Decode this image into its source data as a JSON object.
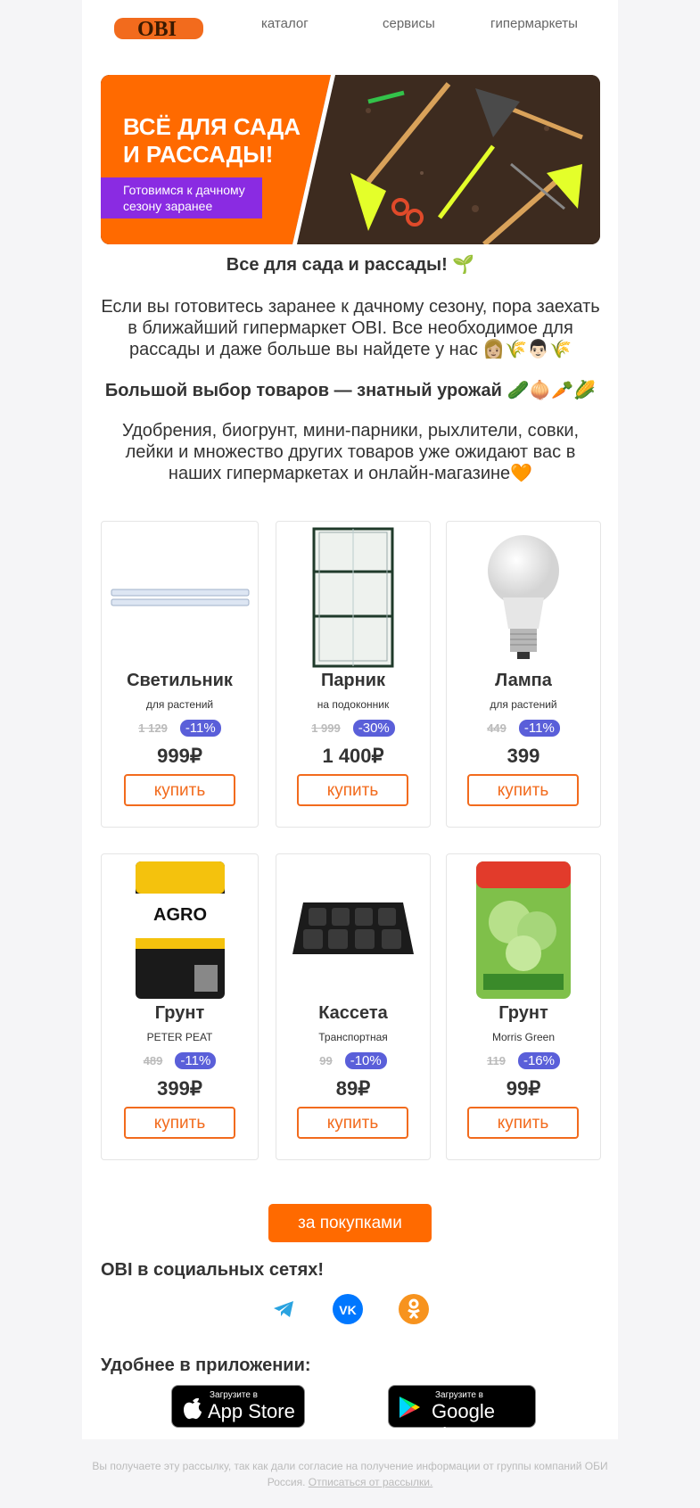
{
  "header": {
    "logo_text": "OBI",
    "nav": [
      "каталог",
      "сервисы",
      "гипермаркеты"
    ]
  },
  "banner": {
    "headline_1": "ВСЁ ДЛЯ САДА",
    "headline_2": "И РАССАДЫ!",
    "tag_1": "Готовимся к дачному",
    "tag_2": "сезону заранее"
  },
  "intro": {
    "title": "Все для сада и рассады! 🌱",
    "p1": "Если вы готовитесь заранее к дачному сезону, пора заехать в ближайший гипермаркет OBI. Все необходимое для рассады и даже больше вы найдете у нас 👩🏼🌾👨🏻🌾",
    "subtitle": "Большой выбор товаров — знатный урожай 🥒🧅🥕🌽",
    "p2": "Удобрения, биогрунт, мини-парники, рыхлители, совки, лейки и множество других товаров уже ожидают вас в наших гипермаркетах и онлайн-магазине🧡"
  },
  "products": [
    {
      "name": "Светильник",
      "sub": "для растений",
      "old": "1 129",
      "discount": "-11%",
      "price": "999₽",
      "button": "купить",
      "image": "led-strip-lamp"
    },
    {
      "name": "Парник",
      "sub": "на подоконник",
      "old": "1 999",
      "discount": "-30%",
      "price": "1 400₽",
      "button": "купить",
      "image": "greenhouse-rack"
    },
    {
      "name": "Лампа",
      "sub": "для растений",
      "old": "449",
      "discount": "-11%",
      "price": "399",
      "button": "купить",
      "image": "light-bulb"
    },
    {
      "name": "Грунт",
      "sub": "PETER PEAT",
      "old": "489",
      "discount": "-11%",
      "price": "399₽",
      "button": "купить",
      "image": "soil-bag-agro"
    },
    {
      "name": "Кассета",
      "sub": "Транспортная",
      "old": "99",
      "discount": "-10%",
      "price": "89₽",
      "button": "купить",
      "image": "seedling-tray"
    },
    {
      "name": "Грунт",
      "sub": "Morris Green",
      "old": "119",
      "discount": "-16%",
      "price": "99₽",
      "button": "купить",
      "image": "soil-bag-green"
    }
  ],
  "cta": "за покупками",
  "social": {
    "title": "OBI в социальных сетях!",
    "icons": [
      "telegram-icon",
      "vk-icon",
      "odnoklassniki-icon"
    ]
  },
  "apps": {
    "title": "Удобнее в приложении:",
    "appstore_small": "Загрузите в",
    "appstore_big": "App Store",
    "google_small": "Загрузите в",
    "google_big": "Google play"
  },
  "footer": {
    "text": "Вы получаете эту рассылку, так как дали согласие на получение информации от группы компаний ОБИ Россия.",
    "unsubscribe": "Отписаться от рассылки."
  },
  "colors": {
    "brand": "#ff6a00",
    "discount": "#5a5fd9",
    "tag": "#8a2be2"
  }
}
